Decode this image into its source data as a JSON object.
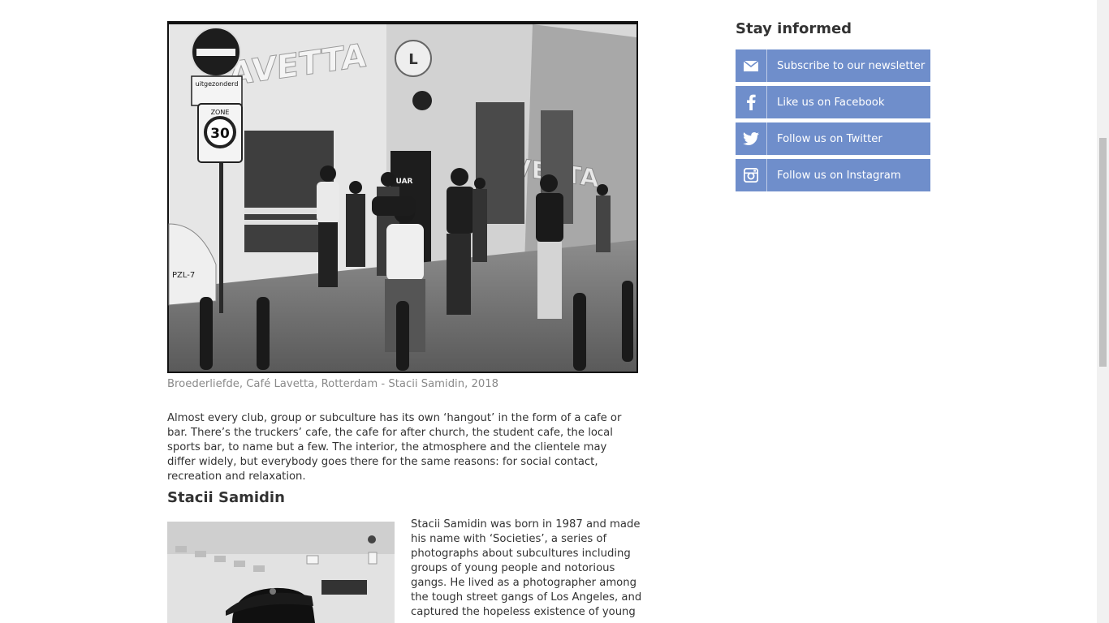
{
  "article": {
    "caption": "Broederliefde, Café Lavetta, Rotterdam - Stacii Samidin, 2018",
    "intro": "Almost every club, group or subculture has its own ‘hangout’ in the form of a cafe or bar. There’s the truckers’ cafe, the cafe for after church, the student cafe, the local sports bar, to name but a few. The interior, the atmosphere and the clientele may differ widely, but everybody goes there for the same reasons: for social contact, recreation and relaxation.",
    "section_title": "Stacii Samidin",
    "bio": "Stacii Samidin was born in 1987 and made his name with ‘Societies’, a series of photographs about subcultures including groups of young people and notorious gangs. He lived as a photographer among the tough street gangs of Los Angeles, and captured the hopeless existence of young"
  },
  "photo_text": {
    "sign_label": "uitgezonderd",
    "zone_label": "ZONE",
    "zone_speed": "30",
    "storefront_left": "LAVETTA",
    "storefront_right": "LAVETTA",
    "logo_letter": "L",
    "plate": "PZL-7",
    "cap_text": "UAR"
  },
  "sidebar": {
    "title": "Stay informed",
    "accent_color": "#6f8ecb",
    "items": [
      {
        "label": "Subscribe to our newsletter",
        "icon": "envelope-icon"
      },
      {
        "label": "Like us on Facebook",
        "icon": "facebook-icon"
      },
      {
        "label": "Follow us on Twitter",
        "icon": "twitter-icon"
      },
      {
        "label": "Follow us on Instagram",
        "icon": "instagram-icon"
      }
    ]
  }
}
